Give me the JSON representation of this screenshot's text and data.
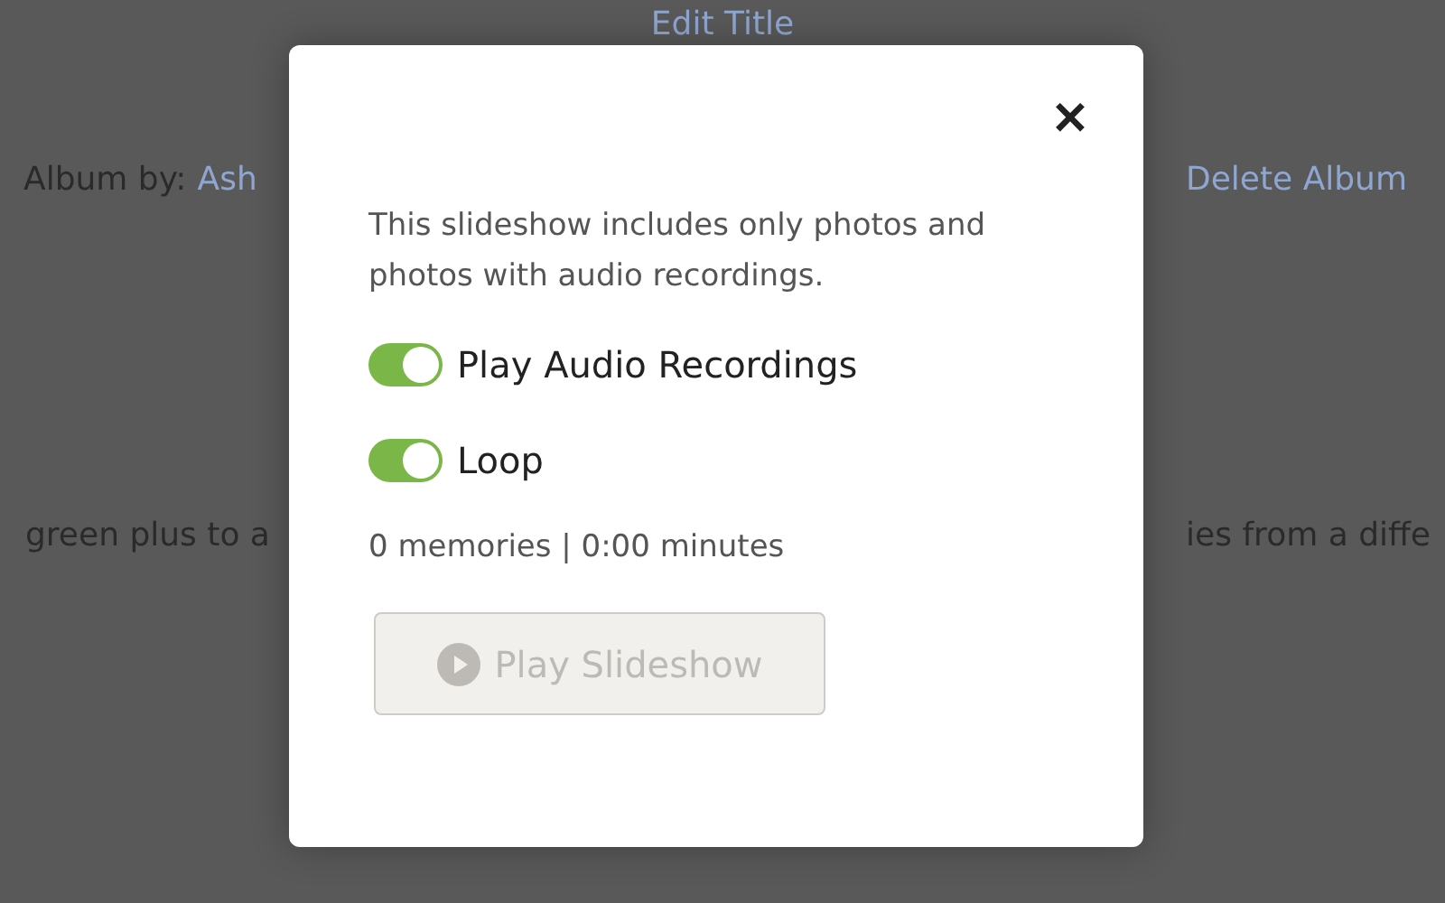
{
  "page": {
    "title_link": "Edit Title",
    "album_by_label": "Album by:",
    "album_by_link": "Ash",
    "delete_link": "Delete Album",
    "hint_left": "green plus to a",
    "hint_right": "ies from a diffe"
  },
  "dialog": {
    "close": "✕",
    "description": "This slideshow includes only photos and photos with audio recordings.",
    "toggles": [
      {
        "label": "Play Audio Recordings",
        "on": true
      },
      {
        "label": "Loop",
        "on": true
      }
    ],
    "stats": "0 memories | 0:00 minutes",
    "button": {
      "label": "Play Slideshow",
      "disabled": true
    }
  }
}
